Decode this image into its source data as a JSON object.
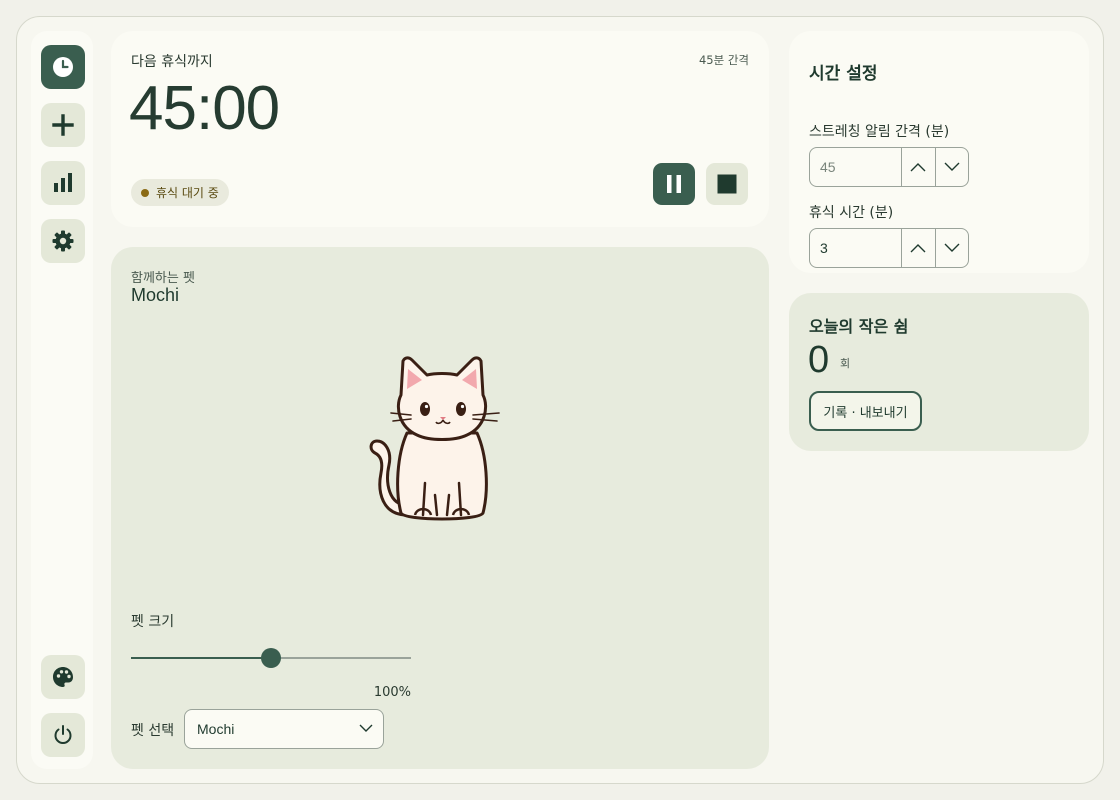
{
  "colors": {
    "accent": "#3a5e4f",
    "status_dot": "#8a6a14",
    "panel": "#e7ebdd"
  },
  "rail": {
    "items": [
      {
        "icon": "clock-icon",
        "active": true
      },
      {
        "icon": "plus-icon",
        "active": false
      },
      {
        "icon": "bar-chart-icon",
        "active": false
      },
      {
        "icon": "gear-icon",
        "active": false
      }
    ],
    "bottom": [
      {
        "icon": "palette-icon"
      },
      {
        "icon": "power-icon"
      }
    ]
  },
  "timer": {
    "label": "다음 휴식까지",
    "interval": "45분 간격",
    "time": "45:00",
    "status": "휴식 대기 중",
    "pause_icon": "pause-icon",
    "stop_icon": "stop-icon"
  },
  "pet": {
    "subtitle": "함께하는 펫",
    "name": "Mochi",
    "image_icon": "cat-icon",
    "size_label": "펫 크기",
    "size_fraction": 0.5,
    "size_value": "100%",
    "select_label": "펫 선택",
    "selected": "Mochi"
  },
  "settings": {
    "title": "시간 설정",
    "stretch_label": "스트레칭 알림 간격 (분)",
    "stretch_value": "45",
    "rest_label": "휴식 시간 (분)",
    "rest_value": "3"
  },
  "today": {
    "title": "오늘의 작은 쉼",
    "count": "0",
    "unit": "회",
    "export_label": "기록 · 내보내기"
  }
}
